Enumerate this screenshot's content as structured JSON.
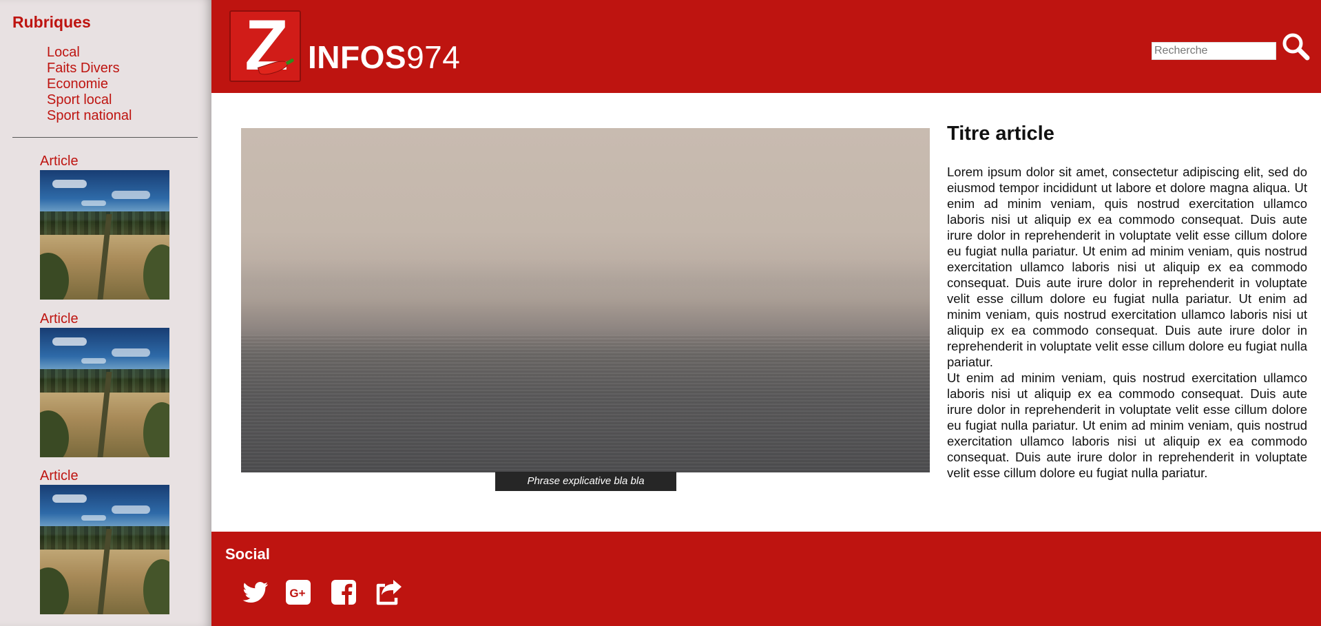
{
  "sidebar": {
    "title": "Rubriques",
    "rubriques": [
      "Local",
      "Faits Divers",
      "Economie",
      "Sport local",
      "Sport national"
    ],
    "articles": [
      {
        "label": "Article"
      },
      {
        "label": "Article"
      },
      {
        "label": "Article"
      }
    ]
  },
  "header": {
    "logo_letter": "Z",
    "logo_bold": "INFOS",
    "logo_light": "974",
    "search_placeholder": "Recherche",
    "search_icon": "search-icon",
    "brand_color": "#be1410"
  },
  "main": {
    "caption": "Phrase explicative bla bla",
    "title": "Titre article",
    "paragraphs": [
      "Lorem ipsum dolor sit amet, consectetur adipiscing elit, sed do eiusmod tempor incididunt ut labore et dolore magna aliqua. Ut enim ad minim veniam, quis nostrud exercitation ullamco laboris nisi ut aliquip ex ea commodo consequat. Duis aute irure dolor in reprehenderit in voluptate velit esse cillum dolore eu fugiat nulla pariatur. Ut enim ad minim veniam, quis nostrud exercitation ullamco laboris nisi ut aliquip ex ea commodo consequat. Duis aute irure dolor in reprehenderit in voluptate velit esse cillum dolore eu fugiat nulla pariatur. Ut enim ad minim veniam, quis nostrud exercitation ullamco laboris nisi ut aliquip ex ea commodo consequat. Duis aute irure dolor in reprehenderit in voluptate velit esse cillum dolore eu fugiat nulla pariatur.",
      "Ut enim ad minim veniam, quis nostrud exercitation ullamco laboris nisi ut aliquip ex ea commodo consequat. Duis aute irure dolor in reprehenderit in voluptate velit esse cillum dolore eu fugiat nulla pariatur. Ut enim ad minim veniam, quis nostrud exercitation ullamco laboris nisi ut aliquip ex ea commodo consequat. Duis aute irure dolor in reprehenderit in voluptate velit esse cillum dolore eu fugiat nulla pariatur."
    ]
  },
  "footer": {
    "title": "Social",
    "icons": [
      "twitter-icon",
      "google-plus-icon",
      "facebook-icon",
      "share-icon"
    ]
  }
}
